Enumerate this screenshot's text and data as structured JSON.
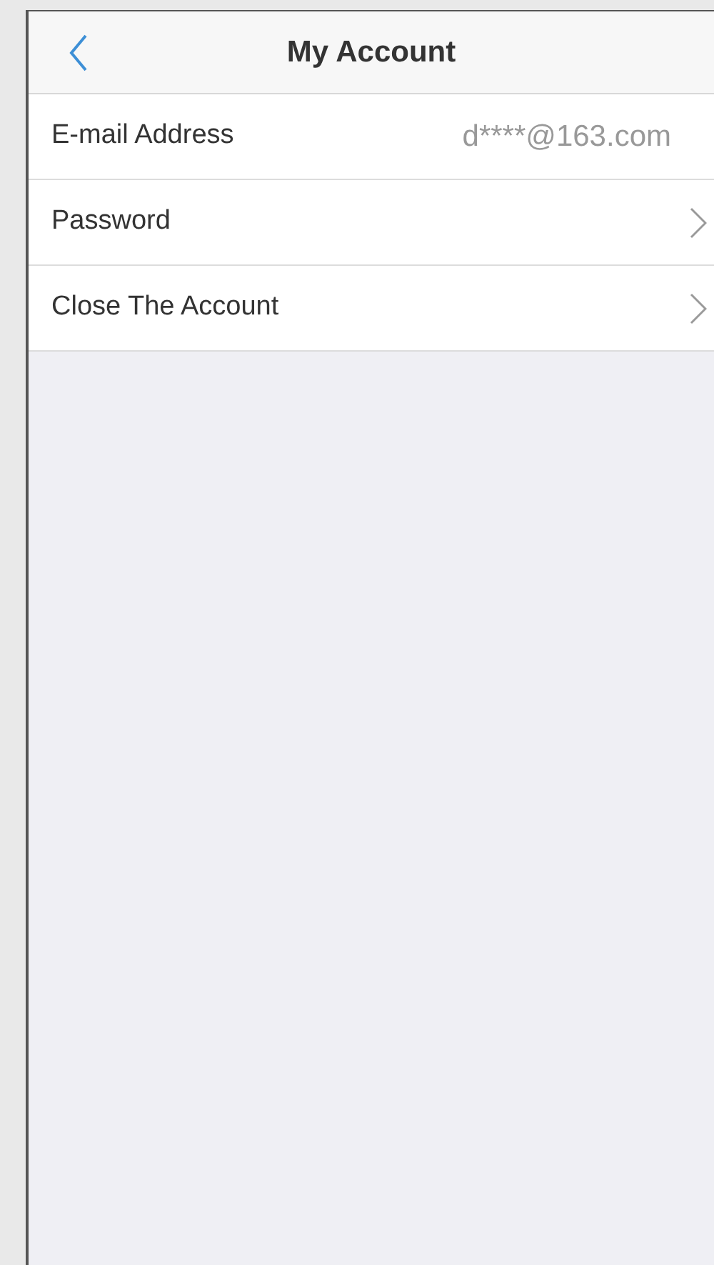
{
  "nav_bar": {
    "title": "My Account"
  },
  "rows": [
    {
      "kind": "value",
      "label": "E-mail Address",
      "value": "d****@163.com"
    },
    {
      "kind": "link",
      "label": "Password"
    },
    {
      "kind": "link",
      "label": "Close The Account"
    }
  ]
}
